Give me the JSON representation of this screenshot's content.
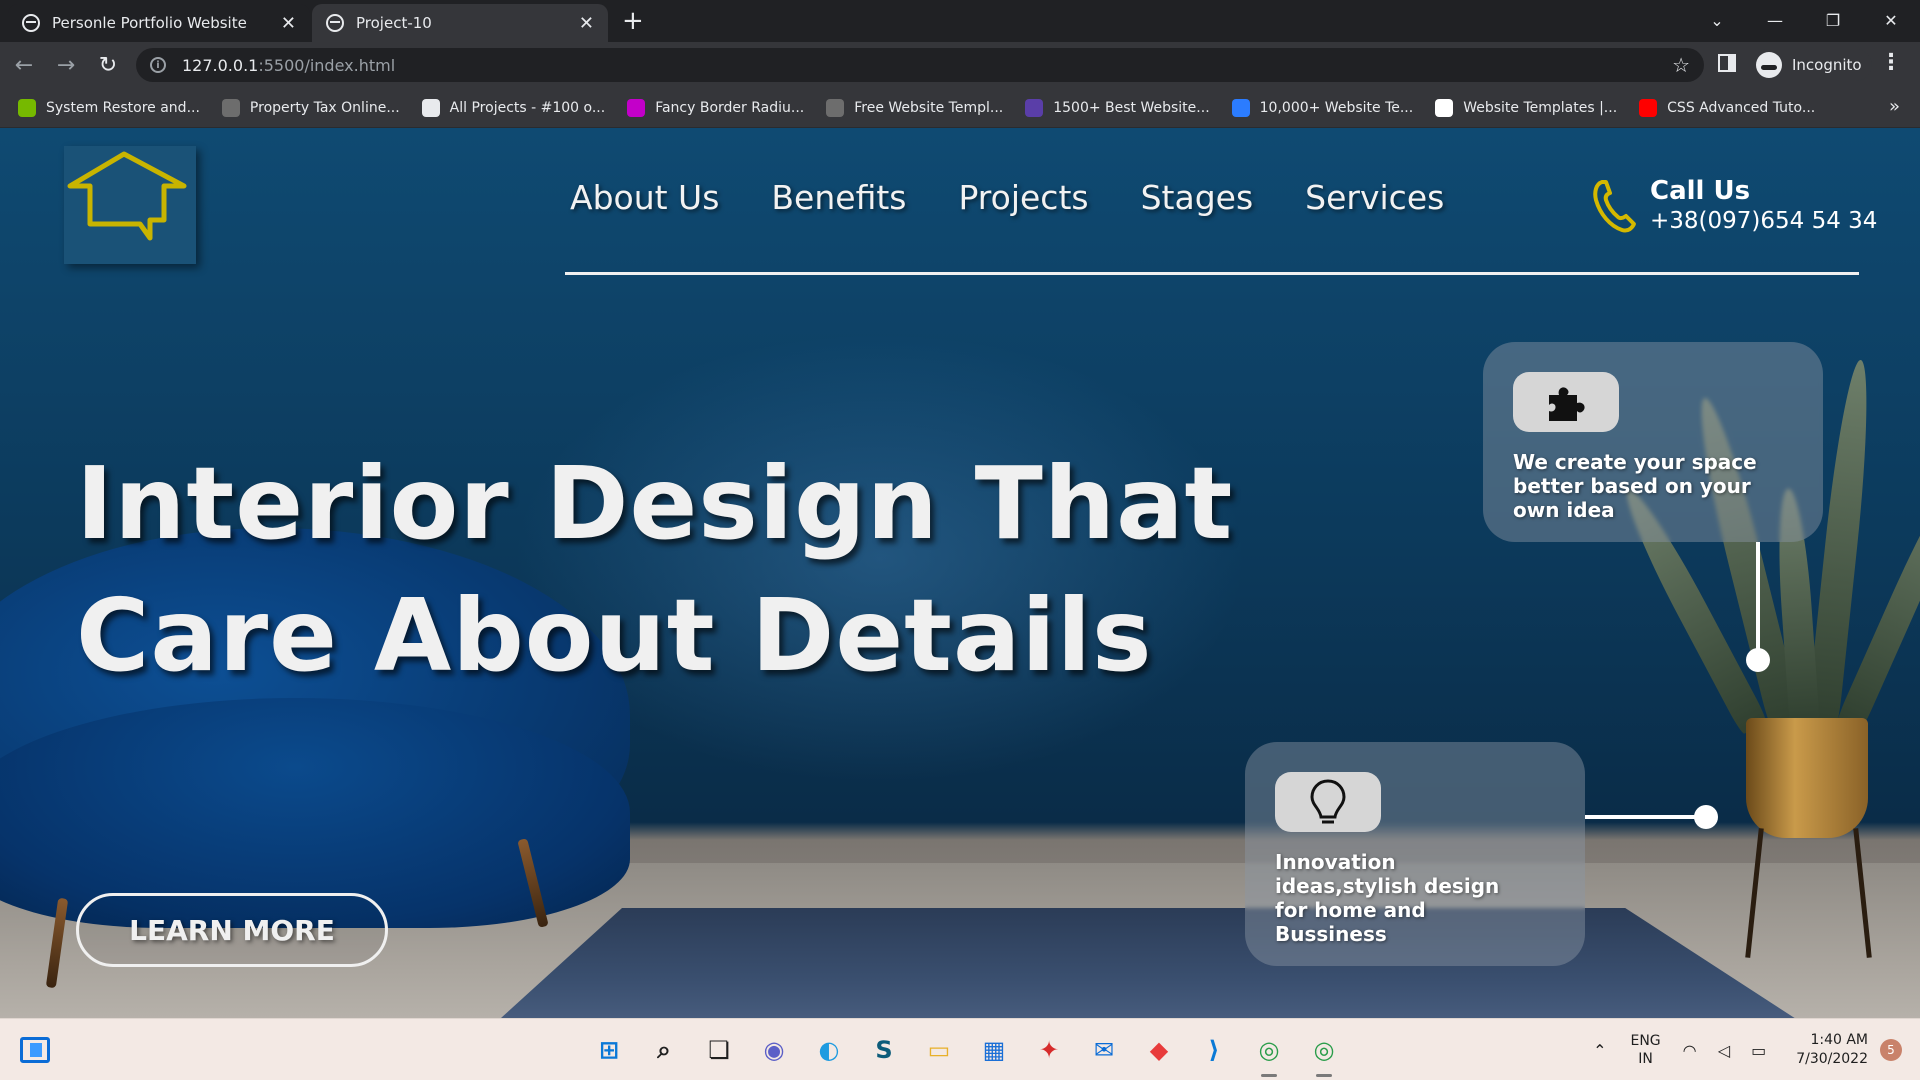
{
  "browser": {
    "tabs": [
      {
        "title": "Personle Portfolio Website",
        "active": false
      },
      {
        "title": "Project-10",
        "active": true
      }
    ],
    "new_tab_glyph": "+",
    "url_host": "127.0.0.1",
    "url_path": ":5500/index.html",
    "profile_label": "Incognito",
    "bookmarks": [
      {
        "label": "System Restore and...",
        "icon": "nvidia-icon",
        "color": "#76b900"
      },
      {
        "label": "Property Tax Online...",
        "icon": "globe-icon",
        "color": "#6d6d6d"
      },
      {
        "label": "All Projects - #100 o...",
        "icon": "codepen-icon",
        "color": "#e8eaed"
      },
      {
        "label": "Fancy Border Radiu...",
        "icon": "fancy-border-icon",
        "color": "#c300c9"
      },
      {
        "label": "Free Website Templ...",
        "icon": "globe-icon",
        "color": "#6d6d6d"
      },
      {
        "label": "1500+ Best Website...",
        "icon": "colorlib-icon",
        "color": "#5a3ea8"
      },
      {
        "label": "10,000+ Website Te...",
        "icon": "nicepage-icon",
        "color": "#2b7cff"
      },
      {
        "label": "Website Templates |...",
        "icon": "wix-icon",
        "color": "#ffffff"
      },
      {
        "label": "CSS Advanced Tuto...",
        "icon": "youtube-icon",
        "color": "#ff0000"
      }
    ],
    "bookmarks_more": "»"
  },
  "site": {
    "nav": [
      "About Us",
      "Benefits",
      "Projects",
      "Stages",
      "Services"
    ],
    "call": {
      "title": "Call Us",
      "number": "+38(097)654 54 34"
    },
    "hero_line1": "Interior Design That",
    "hero_line2": "Care About Details",
    "cta_label": "LEARN MORE",
    "cards": [
      {
        "text": "We create your space better based on your own idea",
        "icon": "puzzle-icon"
      },
      {
        "text": "Innovation ideas,stylish design for home and Bussiness",
        "icon": "lightbulb-icon"
      }
    ],
    "colors": {
      "logo": "#c8b400",
      "phone": "#d4b800",
      "background": "#0c3a5c"
    }
  },
  "taskbar": {
    "apps": [
      {
        "name": "start-icon",
        "color": "#0a78d7"
      },
      {
        "name": "search-icon",
        "color": "#202020"
      },
      {
        "name": "task-view-icon",
        "color": "#202020"
      },
      {
        "name": "teams-icon",
        "color": "#5b5fc7"
      },
      {
        "name": "edge-icon",
        "color": "#1e9be0"
      },
      {
        "name": "app-s-icon",
        "color": "#0c5c7a"
      },
      {
        "name": "file-explorer-icon",
        "color": "#e8b02a"
      },
      {
        "name": "store-icon",
        "color": "#1a6fd6"
      },
      {
        "name": "gift-icon",
        "color": "#d62b2b"
      },
      {
        "name": "mail-icon",
        "color": "#0a6cd6"
      },
      {
        "name": "anydesk-icon",
        "color": "#e83b3b"
      },
      {
        "name": "vscode-icon",
        "color": "#0a7ad6"
      },
      {
        "name": "chrome-icon",
        "color": "#2a9d4a"
      },
      {
        "name": "chrome-profile-icon",
        "color": "#2a9d4a"
      }
    ],
    "lang_line1": "ENG",
    "lang_line2": "IN",
    "time": "1:40 AM",
    "date": "7/30/2022",
    "notifications": "5"
  }
}
